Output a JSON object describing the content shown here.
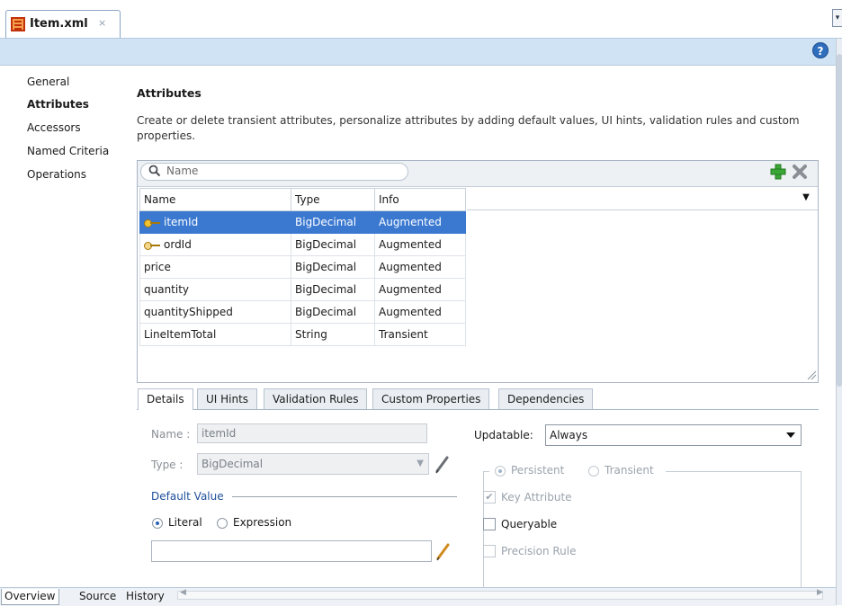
{
  "editor_tab": {
    "title": "Item.xml",
    "close_glyph": "×"
  },
  "help_glyph": "?",
  "left_nav": {
    "items": [
      {
        "label": "General"
      },
      {
        "label": "Attributes",
        "active": true
      },
      {
        "label": "Accessors"
      },
      {
        "label": "Named Criteria"
      },
      {
        "label": "Operations"
      }
    ]
  },
  "section": {
    "title": "Attributes",
    "description": "Create or delete transient attributes, personalize attributes by adding default values, UI hints, validation rules and custom properties."
  },
  "search": {
    "placeholder": "Name"
  },
  "table": {
    "columns": [
      "Name",
      "Type",
      "Info"
    ],
    "rows": [
      {
        "name": "itemId",
        "type": "BigDecimal",
        "info": "Augmented",
        "icon": "primary-key-icon",
        "selected": true
      },
      {
        "name": "ordId",
        "type": "BigDecimal",
        "info": "Augmented",
        "icon": "foreign-key-icon"
      },
      {
        "name": "price",
        "type": "BigDecimal",
        "info": "Augmented"
      },
      {
        "name": "quantity",
        "type": "BigDecimal",
        "info": "Augmented"
      },
      {
        "name": "quantityShipped",
        "type": "BigDecimal",
        "info": "Augmented"
      },
      {
        "name": "LineItemTotal",
        "type": "String",
        "info": "Transient"
      }
    ]
  },
  "subtabs": [
    "Details",
    "UI Hints",
    "Validation Rules",
    "Custom Properties",
    "Dependencies"
  ],
  "details": {
    "name_label": "Name :",
    "name_value": "itemId",
    "type_label": "Type :",
    "type_value": "BigDecimal",
    "default_value_label": "Default Value",
    "literal_label": "Literal",
    "expression_label": "Expression",
    "literal_value": "",
    "updatable_label": "Updatable:",
    "updatable_value": "Always",
    "persistent_label": "Persistent",
    "transient_label": "Transient",
    "key_attribute_label": "Key Attribute",
    "queryable_label": "Queryable",
    "precision_rule_label": "Precision Rule",
    "key_attribute_checked": true,
    "queryable_checked": false,
    "precision_rule_checked": false
  },
  "bottom_tabs": [
    "Overview",
    "Source",
    "History"
  ],
  "colors": {
    "selection": "#3b79d1",
    "header_strip": "#cfe3f5",
    "add": "#3aa635",
    "delete": "#8a8f95"
  }
}
